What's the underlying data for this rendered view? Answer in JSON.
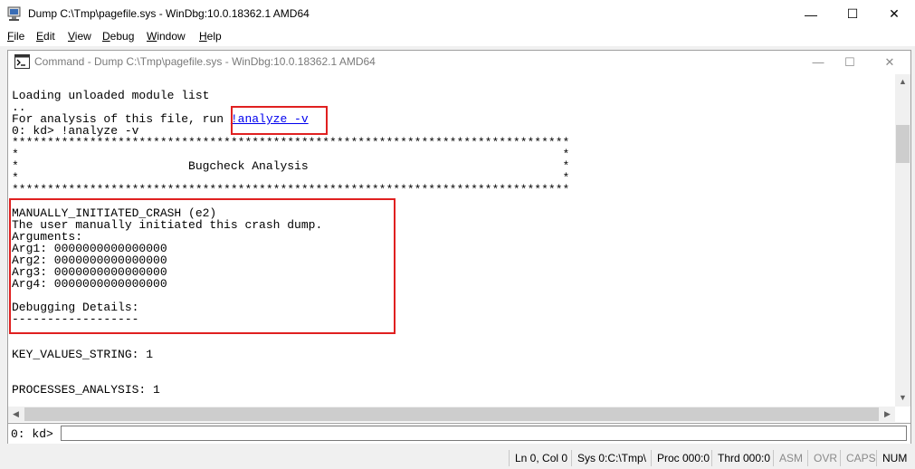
{
  "window": {
    "title": "Dump C:\\Tmp\\pagefile.sys - WinDbg:10.0.18362.1 AMD64",
    "minimize": "—",
    "maximize": "☐",
    "close": "✕"
  },
  "menu": {
    "items": [
      {
        "first": "F",
        "rest": "ile"
      },
      {
        "first": "E",
        "rest": "dit"
      },
      {
        "first": "V",
        "rest": "iew"
      },
      {
        "first": "D",
        "rest": "ebug"
      },
      {
        "first": "W",
        "rest": "indow"
      },
      {
        "first": "H",
        "rest": "elp"
      }
    ]
  },
  "child": {
    "title": "Command - Dump C:\\Tmp\\pagefile.sys - WinDbg:10.0.18362.1 AMD64",
    "minimize": "—",
    "maximize": "☐",
    "close": "✕"
  },
  "output": {
    "loading": "Loading unloaded module list",
    "dots": "..",
    "analysis_prefix": "For analysis of this file, run ",
    "analysis_link": "!analyze -v",
    "prompt_cmd": "0: kd> !analyze -v",
    "stars": "*******************************************************************************",
    "star_blank": "*                                                                             *",
    "bugcheck": "*                        Bugcheck Analysis                                    *",
    "crash_code": "MANUALLY_INITIATED_CRASH (e2)",
    "crash_desc": "The user manually initiated this crash dump.",
    "arguments": "Arguments:",
    "arg1": "Arg1: 0000000000000000",
    "arg2": "Arg2: 0000000000000000",
    "arg3": "Arg3: 0000000000000000",
    "arg4": "Arg4: 0000000000000000",
    "debug_details": "Debugging Details:",
    "dashes": "------------------",
    "key_values": "KEY_VALUES_STRING: 1",
    "processes": "PROCESSES_ANALYSIS: 1"
  },
  "commandline": {
    "prompt": "0: kd>",
    "value": ""
  },
  "status": {
    "ln_col": "Ln 0, Col 0",
    "sys": "Sys 0:C:\\Tmp\\",
    "proc": "Proc 000:0",
    "thrd": "Thrd 000:0",
    "asm": "ASM",
    "ovr": "OVR",
    "caps": "CAPS",
    "num": "NUM"
  }
}
